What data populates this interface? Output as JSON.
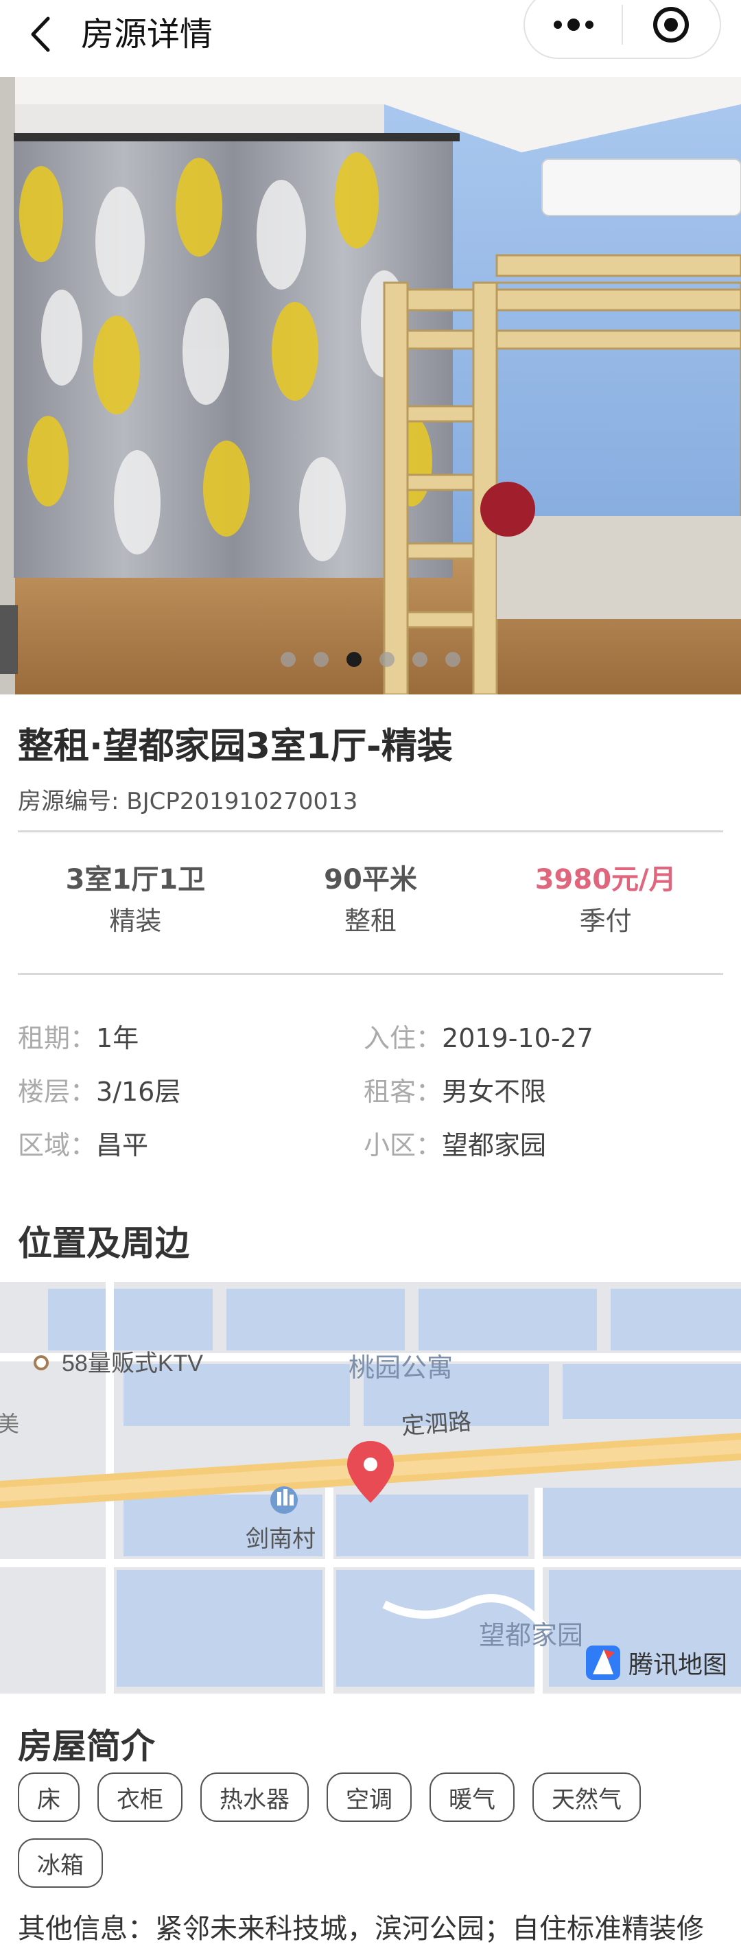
{
  "header": {
    "title": "房源详情",
    "back_icon": "chevron-left-icon",
    "more_icon": "more-dots-icon",
    "close_icon": "target-close-icon"
  },
  "gallery": {
    "image_count": 6,
    "active_index": 3,
    "description_icon": "room-photo"
  },
  "listing": {
    "title": "整租·望都家园3室1厅-精装",
    "code_label": "房源编号: BJCP201910270013",
    "stats": [
      {
        "main": "3室1厅1卫",
        "sub": "精装"
      },
      {
        "main": "90平米",
        "sub": "整租"
      },
      {
        "main": "3980元/月",
        "sub": "季付"
      }
    ],
    "price_color": "#e0667d",
    "facts": [
      {
        "k": "租期：",
        "v": "1年"
      },
      {
        "k": "入住：",
        "v": "2019-10-27"
      },
      {
        "k": "楼层：",
        "v": "3/16层"
      },
      {
        "k": "租客：",
        "v": "男女不限"
      },
      {
        "k": "区域：",
        "v": "昌平"
      },
      {
        "k": "小区：",
        "v": "望都家园"
      }
    ]
  },
  "location": {
    "section_title": "位置及周边",
    "map": {
      "poi_ktv": "58量贩式KTV",
      "poi_taoyuan": "桃园公寓",
      "road": "定泗路",
      "village": "剑南村",
      "community": "望都家园",
      "edge_label": "美",
      "provider": "腾讯地图"
    }
  },
  "intro": {
    "section_title": "房屋简介",
    "tags": [
      "床",
      "衣柜",
      "热水器",
      "空调",
      "暖气",
      "天然气",
      "冰箱"
    ],
    "other_info": "其他信息：紧邻未来科技城，滨河公园；自住标准精装修"
  }
}
